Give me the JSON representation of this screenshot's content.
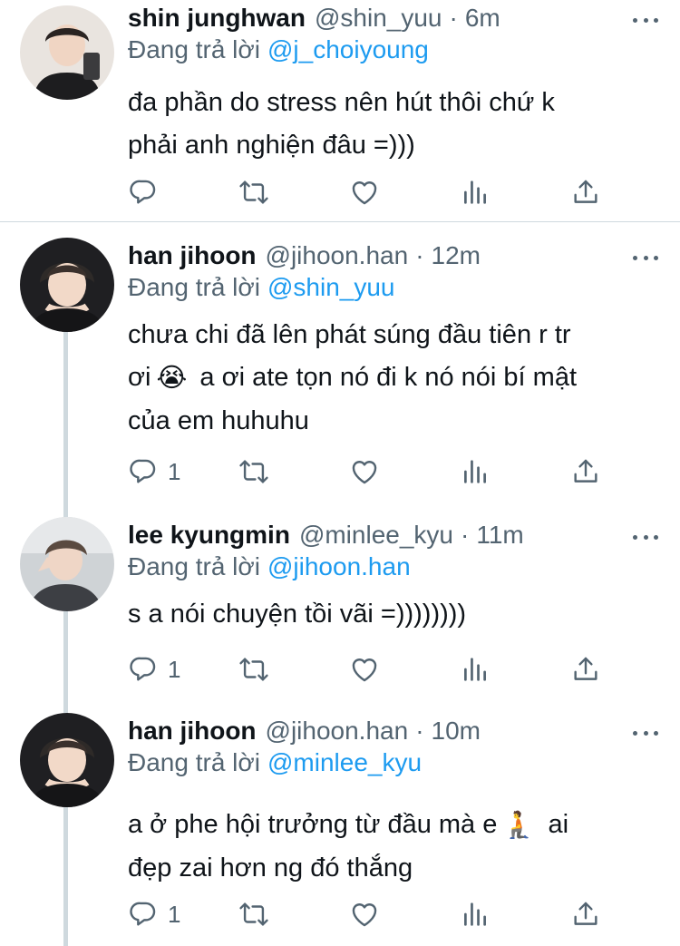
{
  "tweets": [
    {
      "name": "shin junghwan",
      "handle": "@shin_yuu",
      "sep": "·",
      "time": "6m",
      "reply_prefix": "Đang trả lời",
      "reply_to": "@j_choiyoung",
      "text": " đa phần do stress nên hút thôi chứ k\nphải anh nghiện đâu =)))",
      "reply_count": "",
      "avatar_icon": "user-avatar"
    },
    {
      "name": "han jihoon",
      "handle": "@jihoon.han",
      "sep": "·",
      "time": "12m",
      "reply_prefix": "Đang trả lời",
      "reply_to": "@shin_yuu",
      "text_a": "chưa chi đã lên phát súng đầu tiên r tr\nơi",
      "emoji": "😭",
      "text_b": " a ơi ate tọn nó đi k nó nói bí mật\ncủa em huhuhu",
      "reply_count": "1",
      "avatar_icon": "user-avatar"
    },
    {
      "name": "lee kyungmin",
      "handle": "@minlee_kyu",
      "sep": "·",
      "time": "11m",
      "reply_prefix": "Đang trả lời",
      "reply_to": "@jihoon.han",
      "text": "s a nói chuyện tồi vãi =))))))))",
      "reply_count": "1",
      "avatar_icon": "user-avatar"
    },
    {
      "name": "han jihoon",
      "handle": "@jihoon.han",
      "sep": "·",
      "time": "10m",
      "reply_prefix": "Đang trả lời",
      "reply_to": "@minlee_kyu",
      "text_a": "a ở phe hội trưởng từ đầu mà e",
      "emoji": "🧎",
      "text_b": " ai\nđẹp zai hơn ng đó thắng",
      "reply_count": "1",
      "avatar_icon": "user-avatar"
    }
  ],
  "icons": {
    "reply": "reply-icon",
    "retweet": "retweet-icon",
    "like": "heart-icon",
    "views": "analytics-icon",
    "share": "share-icon",
    "more": "more-icon"
  },
  "colors": {
    "mention": "#1d9bf0",
    "secondary_text": "#536471",
    "divider": "#cfd9de"
  }
}
